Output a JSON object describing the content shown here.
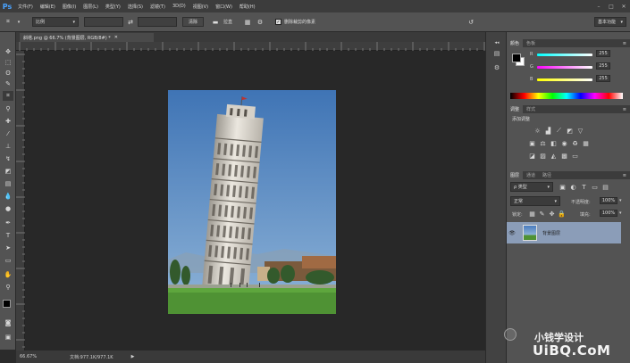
{
  "app": {
    "logo": "Ps"
  },
  "menu": [
    "文件(F)",
    "编辑(E)",
    "图像(I)",
    "图层(L)",
    "类型(Y)",
    "选择(S)",
    "滤镜(T)",
    "3D(D)",
    "视图(V)",
    "窗口(W)",
    "帮助(H)"
  ],
  "options": {
    "ratio_select": "比例",
    "clear_button": "清除",
    "straighten_label": "拉直",
    "delete_cropped_label": "删除裁剪的像素",
    "workspace_select": "基本功能"
  },
  "document": {
    "tab_title": "斜塔.png @ 66.7% (背景图层, RGB/8#) *",
    "zoom": "66.67%",
    "doc_info": "文档:977.1K/977.1K"
  },
  "color_panel": {
    "tabs": [
      "颜色",
      "色板"
    ],
    "channels": [
      {
        "label": "R",
        "value": "255"
      },
      {
        "label": "G",
        "value": "255"
      },
      {
        "label": "B",
        "value": "255"
      }
    ]
  },
  "adjustments_panel": {
    "tabs": [
      "调整",
      "样式"
    ],
    "add_label": "添加调整"
  },
  "layers_panel": {
    "tabs": [
      "图层",
      "通道",
      "路径"
    ],
    "filter_select": "ρ 类型",
    "blend_mode": "正常",
    "opacity_label": "不透明度:",
    "opacity_value": "100%",
    "lock_label": "锁定:",
    "fill_label": "填充:",
    "fill_value": "100%",
    "layers": [
      {
        "name": "背景图层"
      }
    ]
  },
  "watermark": {
    "name": "小钱学设计",
    "url": "UiBQ.CoM"
  }
}
